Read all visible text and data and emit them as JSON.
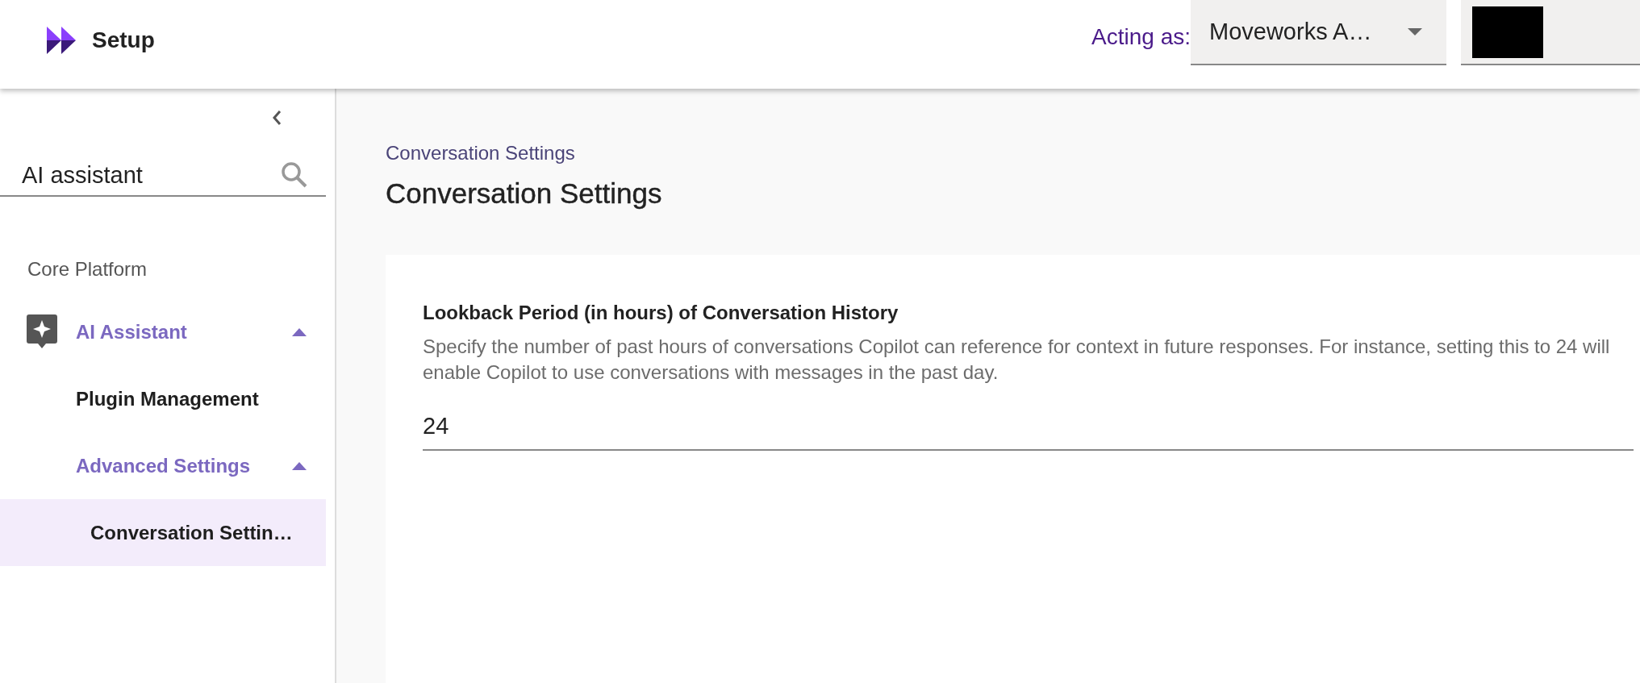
{
  "header": {
    "title": "Setup",
    "acting_as_label": "Acting as:",
    "acting_as_value": "Moveworks A…"
  },
  "sidebar": {
    "search": {
      "value": "AI assistant"
    },
    "section": "Core Platform",
    "items": [
      {
        "label": "AI Assistant",
        "kind": "group",
        "expanded": true,
        "selected": false,
        "children": [
          {
            "label": "Plugin Management",
            "kind": "link",
            "selected": false
          },
          {
            "label": "Advanced Settings",
            "kind": "group",
            "expanded": true,
            "selected": false,
            "children": [
              {
                "label": "Conversation Settin…",
                "kind": "link",
                "selected": true
              }
            ]
          }
        ]
      }
    ]
  },
  "main": {
    "breadcrumb": "Conversation Settings",
    "title": "Conversation Settings",
    "settings": [
      {
        "label": "Lookback Period (in hours) of Conversation History",
        "description": "Specify the number of past hours of conversations Copilot can reference for context in future responses. For instance, setting this to 24 will enable Copilot to use conversations with messages in the past day.",
        "value": "24"
      }
    ]
  }
}
